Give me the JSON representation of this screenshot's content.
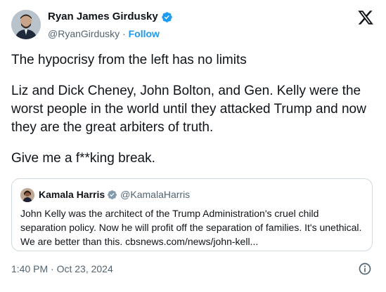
{
  "author": {
    "name": "Ryan James Girdusky",
    "handle": "@RyanGirdusky",
    "separator": " · ",
    "follow_label": "Follow",
    "verified_color": "#1d9bf0"
  },
  "tweet": {
    "paragraphs": [
      "The hypocrisy from the left has no limits",
      "Liz and Dick Cheney, John Bolton, and Gen. Kelly were the worst people in the world until they attacked Trump and now they are the great arbiters of truth.",
      "Give me a f**king break."
    ]
  },
  "quoted_tweet": {
    "name": "Kamala Harris",
    "handle": "@KamalaHarris",
    "verified_color": "#829aab",
    "text": "John Kelly was the architect of the Trump Administration's cruel child separation policy. Now he will profit off the separation of families. It's unethical. We are better than this. cbsnews.com/news/john-kell..."
  },
  "meta": {
    "timestamp": "1:40 PM · Oct 23, 2024"
  },
  "icons": {
    "platform_logo": "x-logo-icon",
    "info": "info-icon",
    "verified": "verified-badge-icon"
  },
  "colors": {
    "text_primary": "#0f1419",
    "text_secondary": "#536471",
    "accent": "#1d9bf0",
    "border": "#cfd9de"
  }
}
